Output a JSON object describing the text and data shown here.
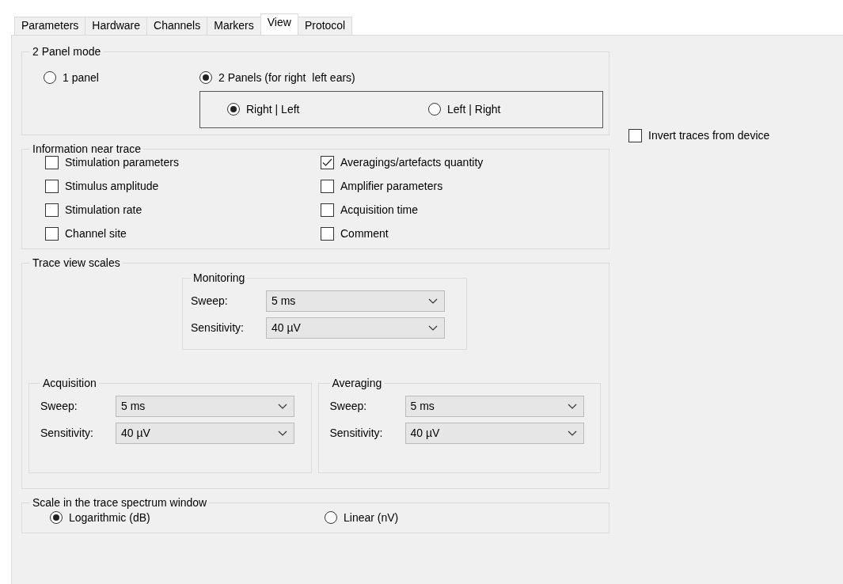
{
  "tabs": [
    {
      "label": "Parameters",
      "selected": false
    },
    {
      "label": "Hardware",
      "selected": false
    },
    {
      "label": "Channels",
      "selected": false
    },
    {
      "label": "Markers",
      "selected": false
    },
    {
      "label": "View",
      "selected": true
    },
    {
      "label": "Protocol",
      "selected": false
    }
  ],
  "panel_mode": {
    "title": "2 Panel mode",
    "options": [
      {
        "label": "1 panel",
        "selected": false
      },
      {
        "label": "2 Panels (for right  left ears)",
        "selected": true
      }
    ],
    "order": [
      {
        "label": "Right | Left",
        "selected": true
      },
      {
        "label": "Left | Right",
        "selected": false
      }
    ]
  },
  "invert": {
    "label": "Invert traces from device",
    "checked": false
  },
  "info": {
    "title": "Information near trace",
    "items": [
      {
        "label": "Stimulation parameters",
        "checked": false
      },
      {
        "label": "Averagings/artefacts quantity",
        "checked": true
      },
      {
        "label": "Stimulus amplitude",
        "checked": false
      },
      {
        "label": "Amplifier parameters",
        "checked": false
      },
      {
        "label": "Stimulation rate",
        "checked": false
      },
      {
        "label": "Acquisition time",
        "checked": false
      },
      {
        "label": "Channel site",
        "checked": false
      },
      {
        "label": "Comment",
        "checked": false
      }
    ]
  },
  "scales": {
    "title": "Trace view scales",
    "groups": [
      {
        "title": "Monitoring",
        "fields": [
          {
            "label": "Sweep:",
            "value": "5 ms"
          },
          {
            "label": "Sensitivity:",
            "value": "40 µV"
          }
        ]
      },
      {
        "title": "Acquisition",
        "fields": [
          {
            "label": "Sweep:",
            "value": "5 ms"
          },
          {
            "label": "Sensitivity:",
            "value": "40 µV"
          }
        ]
      },
      {
        "title": "Averaging",
        "fields": [
          {
            "label": "Sweep:",
            "value": "5 ms"
          },
          {
            "label": "Sensitivity:",
            "value": "40 µV"
          }
        ]
      }
    ]
  },
  "spectrum": {
    "title": "Scale in the trace spectrum window",
    "options": [
      {
        "label": "Logarithmic (dB)",
        "selected": true
      },
      {
        "label": "Linear (nV)",
        "selected": false
      }
    ]
  }
}
